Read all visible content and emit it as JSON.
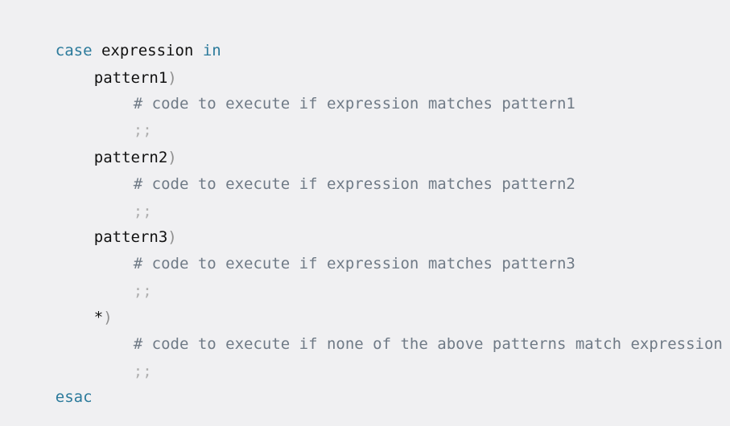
{
  "code": {
    "line1": {
      "kw_case": "case",
      "space1": " ",
      "expr": "expression",
      "space2": " ",
      "kw_in": "in"
    },
    "line2": {
      "pattern": "pattern1",
      "paren": ")"
    },
    "line3": {
      "comment": "# code to execute if expression matches pattern1"
    },
    "line4": {
      "sep": ";;"
    },
    "line5": {
      "pattern": "pattern2",
      "paren": ")"
    },
    "line6": {
      "comment": "# code to execute if expression matches pattern2"
    },
    "line7": {
      "sep": ";;"
    },
    "line8": {
      "pattern": "pattern3",
      "paren": ")"
    },
    "line9": {
      "comment": "# code to execute if expression matches pattern3"
    },
    "line10": {
      "sep": ";;"
    },
    "line11": {
      "pattern": "*",
      "paren": ")"
    },
    "line12": {
      "comment": "# code to execute if none of the above patterns match expression"
    },
    "line13": {
      "sep": ";;"
    },
    "line14": {
      "kw_esac": "esac"
    }
  }
}
